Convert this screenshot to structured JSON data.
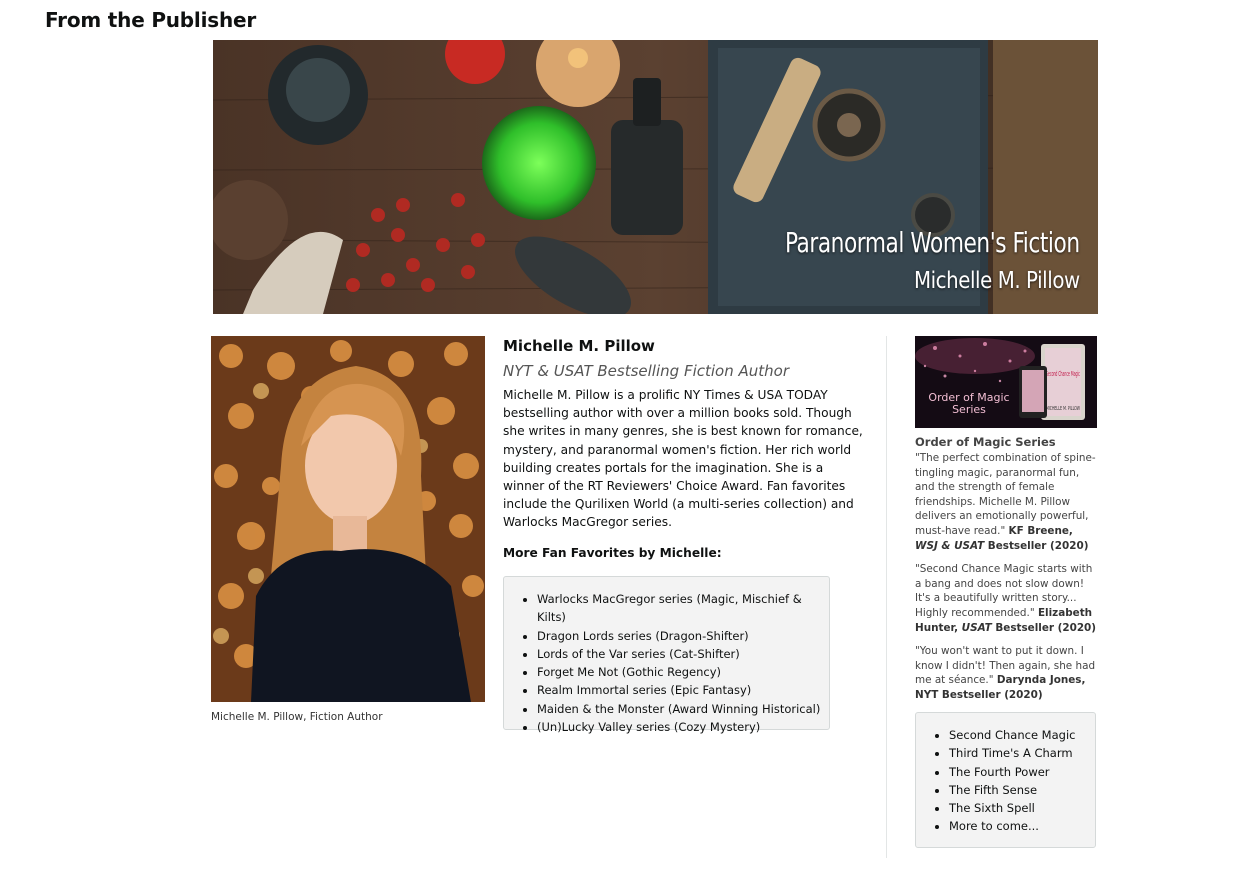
{
  "heading": "From the Publisher",
  "banner": {
    "title": "Paranormal Women's Fiction",
    "author": "Michelle M. Pillow"
  },
  "photo_caption": "Michelle M. Pillow, Fiction Author",
  "author": {
    "name": "Michelle M. Pillow",
    "tagline": "NYT & USAT Bestselling Fiction Author",
    "bio": "Michelle M. Pillow is a prolific NY Times & USA TODAY bestselling author with over a million books sold. Though she writes in many genres, she is best known for romance, mystery, and paranormal women's fiction. Her rich world building creates portals for the imagination. She is a winner of the RT Reviewers' Choice Award. Fan favorites include the Qurilixen World (a multi-series collection) and Warlocks MacGregor series."
  },
  "favorites": {
    "heading": "More Fan Favorites by Michelle:",
    "items": [
      "Warlocks MacGregor series (Magic, Mischief & Kilts)",
      "Dragon Lords series (Dragon-Shifter)",
      "Lords of the Var series (Cat-Shifter)",
      "Forget Me Not (Gothic Regency)",
      "Realm Immortal series (Epic Fantasy)",
      "Maiden & the Monster (Award Winning Historical)",
      "(Un)Lucky Valley series (Cozy Mystery)"
    ]
  },
  "series": {
    "image_text": "Order of Magic Series",
    "cover_title": "Second Chance Magic",
    "cover_author": "MICHELLE M. PILLOW",
    "title": "Order of Magic Series",
    "quotes": [
      {
        "text": "\"The perfect combination of spine-tingling magic, paranormal fun, and the strength of female friendships. Michelle M. Pillow delivers an emotionally powerful, must-have read.\"",
        "attr_a": "KF Breene, ",
        "attr_em": "WSJ & USAT",
        "attr_b": " Bestseller (2020)"
      },
      {
        "text": "\"Second Chance Magic starts with a bang and does not slow down! It's a beautifully written story... Highly recommended.\"",
        "attr_a": "Elizabeth Hunter, ",
        "attr_em": "USAT",
        "attr_b": " Bestseller (2020)"
      },
      {
        "text": "\"You won't want to put it down. I know I didn't! Then again, she had me at séance.\"",
        "attr_a": "Darynda Jones, NYT Bestseller (2020)",
        "attr_em": "",
        "attr_b": ""
      }
    ],
    "books": [
      "Second Chance Magic",
      "Third Time's A Charm",
      "The Fourth Power",
      "The Fifth Sense",
      "The Sixth Spell",
      "More to come..."
    ]
  },
  "colors": {
    "box_bg": "#f3f3f3",
    "box_border": "#d5d9d9",
    "text": "#0f1111"
  }
}
